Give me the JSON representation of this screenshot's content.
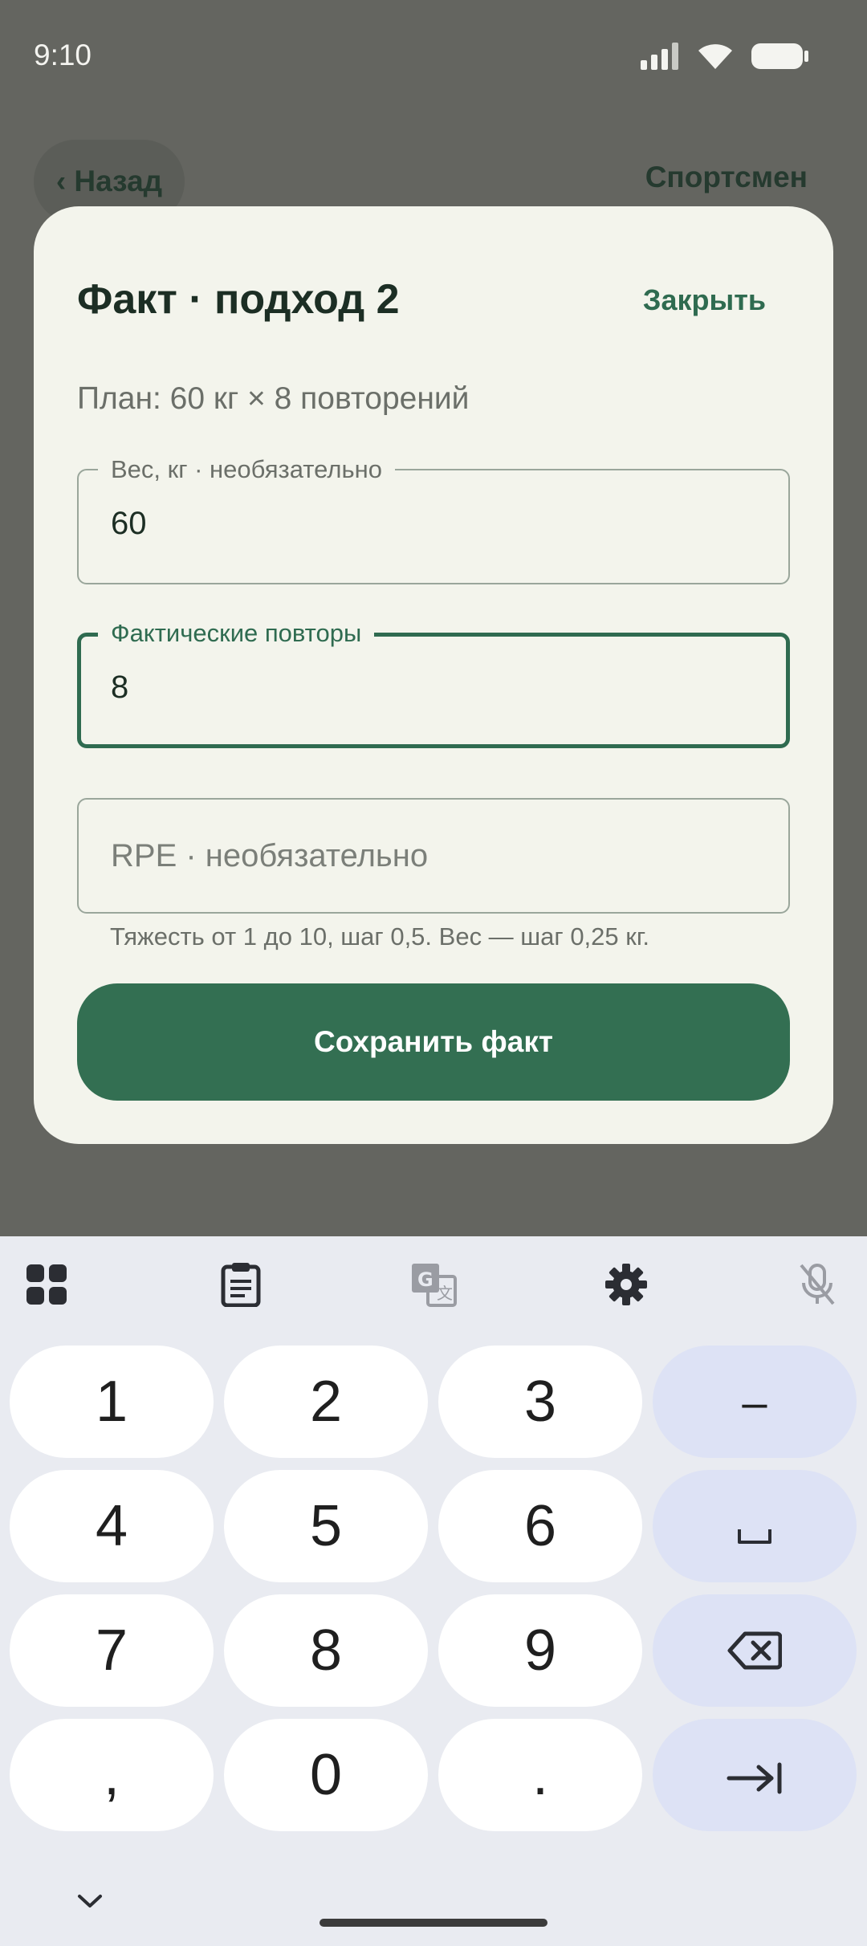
{
  "status_bar": {
    "time": "9:10",
    "icons": [
      "signal-icon",
      "wifi-icon",
      "battery-icon"
    ]
  },
  "header": {
    "back_label": "‹ Назад",
    "athlete_label": "Спортсмен"
  },
  "dialog": {
    "title": "Факт · подход 2",
    "close_label": "Закрыть",
    "plan_text": "План: 60 кг × 8 повторений",
    "weight_field": {
      "label": "Вес, кг · необязательно",
      "value": "60"
    },
    "reps_field": {
      "label": "Фактические повторы",
      "value": "8"
    },
    "rpe_field": {
      "placeholder": "RPE · необязательно",
      "value": ""
    },
    "helper_text": "Тяжесть от 1 до 10, шаг 0,5. Вес — шаг 0,25 кг.",
    "save_label": "Сохранить факт"
  },
  "keyboard": {
    "toolbar_icons": [
      "apps-grid-icon",
      "clipboard-icon",
      "translate-icon",
      "settings-gear-icon",
      "mic-off-icon"
    ],
    "keys": {
      "k1": "1",
      "k2": "2",
      "k3": "3",
      "minus": "–",
      "k4": "4",
      "k5": "5",
      "k6": "6",
      "k7": "7",
      "k8": "8",
      "k9": "9",
      "comma": ",",
      "k0": "0",
      "dot": "."
    },
    "function_keys": [
      "minus-key",
      "space-icon",
      "backspace-icon",
      "tab-next-icon"
    ]
  },
  "colors": {
    "accent_green": "#336f52",
    "dialog_bg": "#f3f4ec",
    "scrim": "#646560",
    "keyboard_bg": "#e9ebf1",
    "function_key_bg": "#dde2f5"
  }
}
